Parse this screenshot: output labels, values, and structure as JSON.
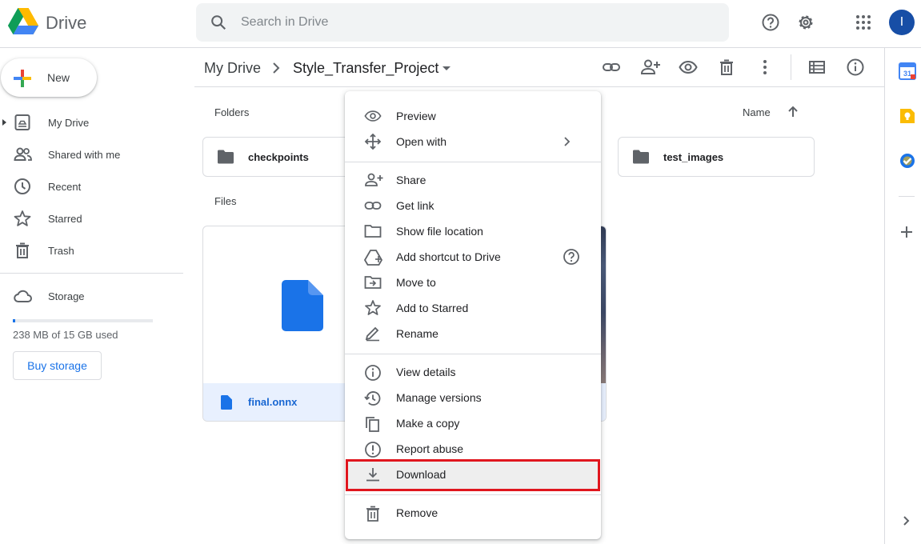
{
  "app": {
    "name": "Drive"
  },
  "search": {
    "placeholder": "Search in Drive",
    "value": ""
  },
  "user": {
    "avatar_letter": "I"
  },
  "sidebar": {
    "new_label": "New",
    "items": [
      {
        "label": "My Drive",
        "icon": "my-drive-icon"
      },
      {
        "label": "Shared with me",
        "icon": "people-icon"
      },
      {
        "label": "Recent",
        "icon": "clock-icon"
      },
      {
        "label": "Starred",
        "icon": "star-icon"
      },
      {
        "label": "Trash",
        "icon": "trash-icon"
      }
    ],
    "storage_label": "Storage",
    "storage_used_text": "238 MB of 15 GB used",
    "storage_used_fraction": 0.0155,
    "buy_storage": "Buy storage"
  },
  "breadcrumb": {
    "root": "My Drive",
    "current": "Style_Transfer_Project"
  },
  "content": {
    "folders_heading": "Folders",
    "files_heading": "Files",
    "sort_label": "Name",
    "folders": [
      "checkpoints",
      "test_images"
    ],
    "files": [
      "final.onnx"
    ]
  },
  "context_menu": {
    "items": [
      {
        "label": "Preview",
        "icon": "eye-icon"
      },
      {
        "label": "Open with",
        "icon": "move-arrows-icon"
      },
      {
        "label": "Share",
        "icon": "add-person-icon"
      },
      {
        "label": "Get link",
        "icon": "link-icon"
      },
      {
        "label": "Show file location",
        "icon": "folder-outline-icon"
      },
      {
        "label": "Add shortcut to Drive",
        "icon": "drive-shortcut-icon"
      },
      {
        "label": "Move to",
        "icon": "move-folder-icon"
      },
      {
        "label": "Add to Starred",
        "icon": "star-icon"
      },
      {
        "label": "Rename",
        "icon": "pencil-icon"
      },
      {
        "label": "View details",
        "icon": "info-icon"
      },
      {
        "label": "Manage versions",
        "icon": "history-icon"
      },
      {
        "label": "Make a copy",
        "icon": "copy-icon"
      },
      {
        "label": "Report abuse",
        "icon": "alert-icon"
      },
      {
        "label": "Download",
        "icon": "download-icon"
      },
      {
        "label": "Remove",
        "icon": "trash-icon"
      }
    ],
    "highlighted": "Download",
    "highlight_color": "#e0161e"
  },
  "colors": {
    "accent": "#1a73e8",
    "selected_bg": "#e8f0fe",
    "icon_gray": "#5f6368"
  }
}
